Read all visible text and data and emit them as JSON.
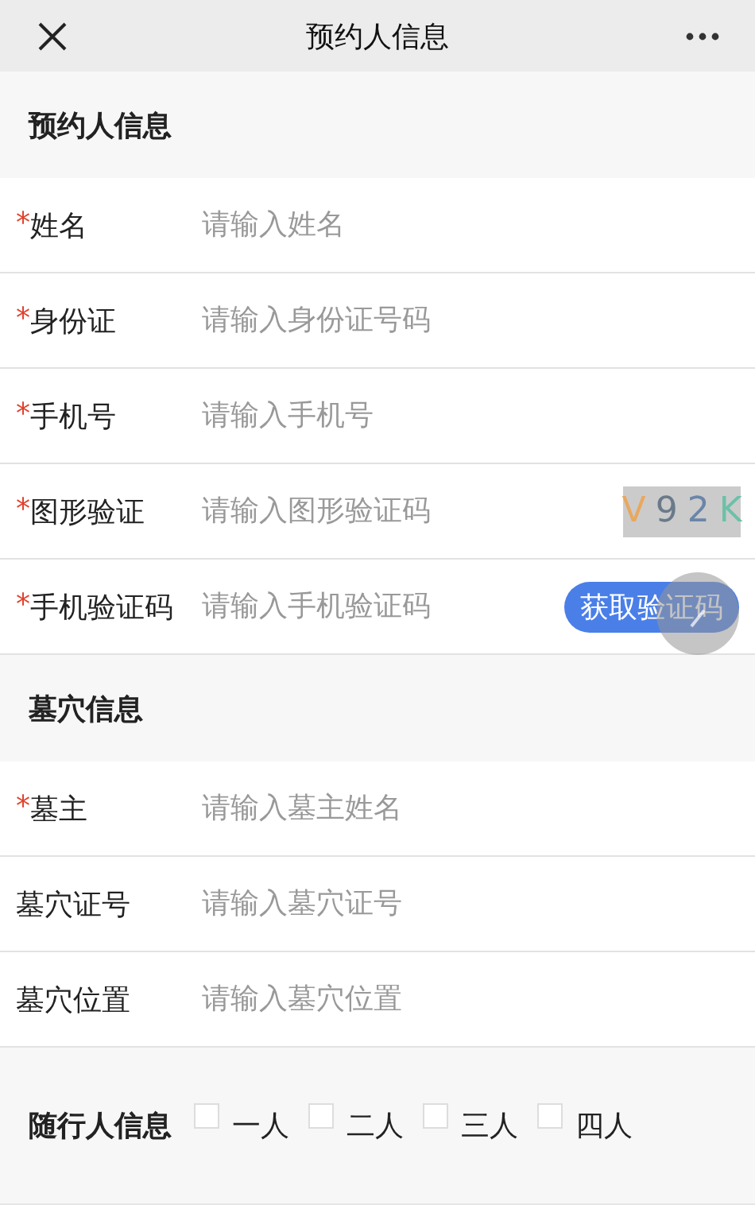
{
  "window": {
    "title": "预约人信息"
  },
  "sections": [
    {
      "title": "预约人信息",
      "fields": [
        {
          "kind": "text",
          "label": "姓名",
          "required_mark": "*",
          "placeholder": "请输入姓名"
        },
        {
          "kind": "text",
          "label": "身份证",
          "required_mark": "*",
          "placeholder": "请输入身份证号码"
        },
        {
          "kind": "text",
          "label": "手机号",
          "required_mark": "*",
          "placeholder": "请输入手机号"
        },
        {
          "kind": "captcha",
          "label": "图形验证",
          "required_mark": "*",
          "placeholder": "请输入图形验证码",
          "captcha": [
            {
              "char": "V",
              "color": "#e8a860"
            },
            {
              "char": "9",
              "color": "#6a7a8a"
            },
            {
              "char": "2",
              "color": "#6a86a8"
            },
            {
              "char": "K",
              "color": "#6cc0a8"
            }
          ]
        },
        {
          "kind": "sms",
          "label": "手机验证码",
          "required_mark": "*",
          "placeholder": "请输入手机验证码",
          "button": "获取验证码"
        }
      ]
    },
    {
      "title": "墓穴信息",
      "fields": [
        {
          "kind": "text",
          "label": "墓主",
          "required_mark": "*",
          "placeholder": "请输入墓主姓名"
        },
        {
          "kind": "text",
          "label": "墓穴证号",
          "placeholder": "请输入墓穴证号"
        },
        {
          "kind": "text",
          "label": "墓穴位置",
          "placeholder": "请输入墓穴位置"
        }
      ]
    }
  ],
  "companions": {
    "label": "随行人信息",
    "options": [
      {
        "label": "一人",
        "checked": false
      },
      {
        "label": "二人",
        "checked": false
      },
      {
        "label": "三人",
        "checked": false
      },
      {
        "label": "四人",
        "checked": false
      }
    ]
  }
}
